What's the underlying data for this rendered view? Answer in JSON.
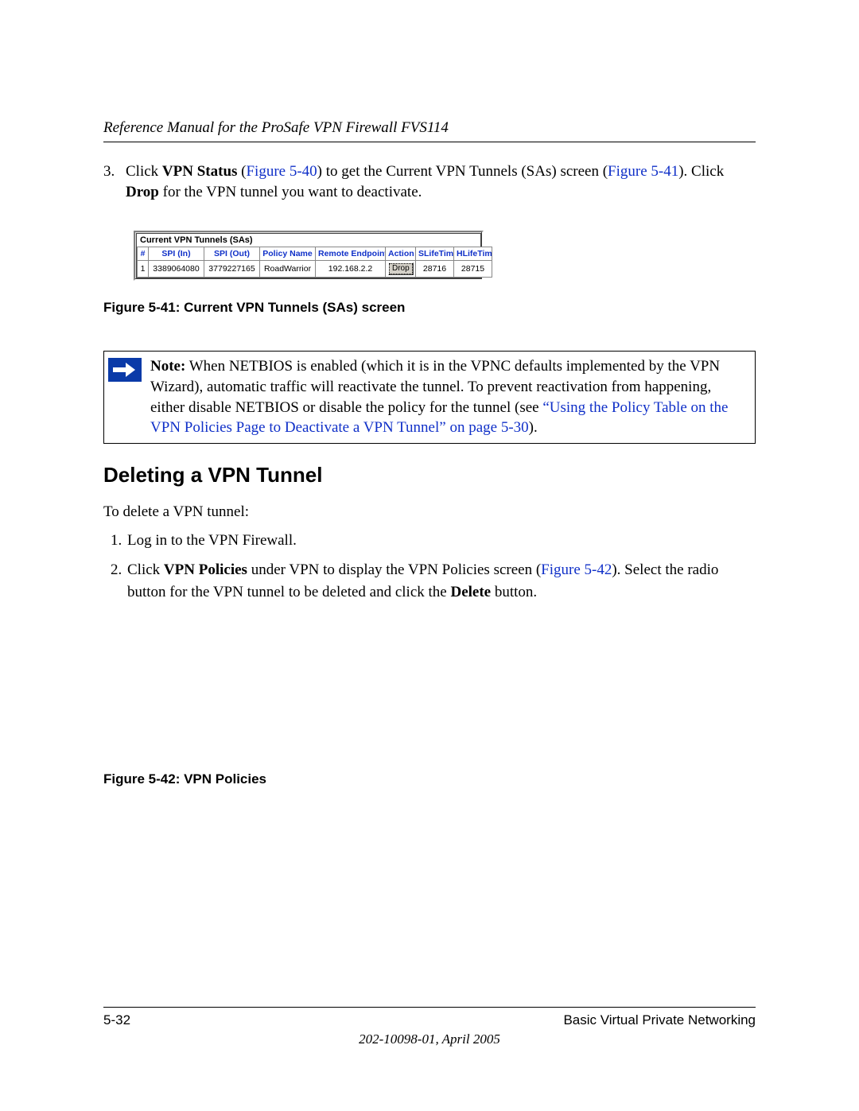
{
  "header": {
    "title": "Reference Manual for the ProSafe VPN Firewall FVS114"
  },
  "step3": {
    "num": "3.",
    "t1": "Click ",
    "b1": "VPN Status",
    "t2": " (",
    "l1": "Figure 5-40",
    "t3": ") to get the Current VPN Tunnels (SAs) screen (",
    "l2": "Figure 5-41",
    "t4": "). Click ",
    "b2": "Drop",
    "t5": " for the VPN tunnel you want to deactivate."
  },
  "sa_table": {
    "title": "Current VPN Tunnels (SAs)",
    "headers": [
      "#",
      "SPI (In)",
      "SPI (Out)",
      "Policy Name",
      "Remote Endpoint",
      "Action",
      "SLifeTime",
      "HLifeTime"
    ],
    "row": {
      "n": "1",
      "spi_in": "3389064080",
      "spi_out": "3779227165",
      "policy": "RoadWarrior",
      "endpoint": "192.168.2.2",
      "action": "Drop",
      "slife": "28716",
      "hlife": "28715"
    }
  },
  "figcap1": "Figure 5-41:  Current VPN Tunnels (SAs) screen",
  "note": {
    "b": "Note:",
    "t1": " When NETBIOS is enabled (which it is in the VPNC defaults implemented by the VPN Wizard), automatic traffic will reactivate the tunnel. To prevent reactivation from happening, either disable NETBIOS or disable the policy for the tunnel (see ",
    "l1": "“Using the Policy Table on the VPN Policies Page to Deactivate a VPN Tunnel” on page 5-30",
    "t2": ")."
  },
  "section_heading": "Deleting a VPN Tunnel",
  "intro": "To delete a VPN tunnel:",
  "steps": {
    "s1": "Log in to the VPN Firewall.",
    "s2a": "Click ",
    "s2b": "VPN Policies",
    "s2c": " under VPN to display the VPN Policies screen (",
    "s2l": "Figure 5-42",
    "s2d": "). Select the radio button for the VPN tunnel to be deleted and click the ",
    "s2e": "Delete",
    "s2f": " button."
  },
  "figcap2": "Figure 5-42:  VPN Policies",
  "footer": {
    "page": "5-32",
    "section": "Basic Virtual Private Networking",
    "date": "202-10098-01, April 2005"
  }
}
